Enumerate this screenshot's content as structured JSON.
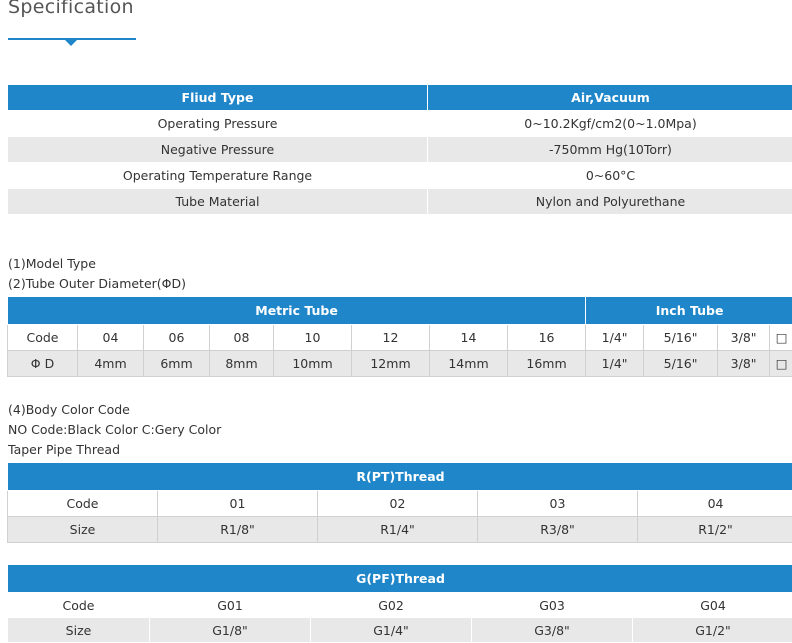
{
  "section": {
    "title": "Specification"
  },
  "spec_table": {
    "header": [
      "Fliud Type",
      "Air,Vacuum"
    ],
    "rows": [
      [
        "Operating Pressure",
        "0~10.2Kgf/cm2(0~1.0Mpa)"
      ],
      [
        "Negative Pressure",
        "-750mm Hg(10Torr)"
      ],
      [
        "Operating Temperature Range",
        "0~60°C"
      ],
      [
        "Tube Material",
        "Nylon and Polyurethane"
      ]
    ]
  },
  "notes": {
    "model_type": "(1)Model Type",
    "tube_od": "(2)Tube Outer Diameter(ΦD)",
    "body_color": "(4)Body Color Code",
    "color_codes": "NO Code:Black Color C:Gery Color",
    "taper": "Taper Pipe Thread"
  },
  "tube_table": {
    "metric_header": "Metric Tube",
    "inch_header": "Inch Tube",
    "rows": [
      [
        "Code",
        "04",
        "06",
        "08",
        "10",
        "12",
        "14",
        "16",
        "1/4\"",
        "5/16\"",
        "3/8\"",
        "□"
      ],
      [
        "Φ D",
        "4mm",
        "6mm",
        "8mm",
        "10mm",
        "12mm",
        "14mm",
        "16mm",
        "1/4\"",
        "5/16\"",
        "3/8\"",
        "□"
      ]
    ]
  },
  "rpt_table": {
    "header": "R(PT)Thread",
    "rows": [
      [
        "Code",
        "01",
        "02",
        "03",
        "04"
      ],
      [
        "Size",
        "R1/8\"",
        "R1/4\"",
        "R3/8\"",
        "R1/2\""
      ]
    ]
  },
  "gpf_table": {
    "header": "G(PF)Thread",
    "rows": [
      [
        "Code",
        "G01",
        "G02",
        "G03",
        "G04"
      ],
      [
        "Size",
        "G1/8\"",
        "G1/4\"",
        "G3/8\"",
        "G1/2\""
      ]
    ]
  },
  "colors": {
    "accent": "#1f86c9",
    "stripe": "#e8e8e8"
  }
}
